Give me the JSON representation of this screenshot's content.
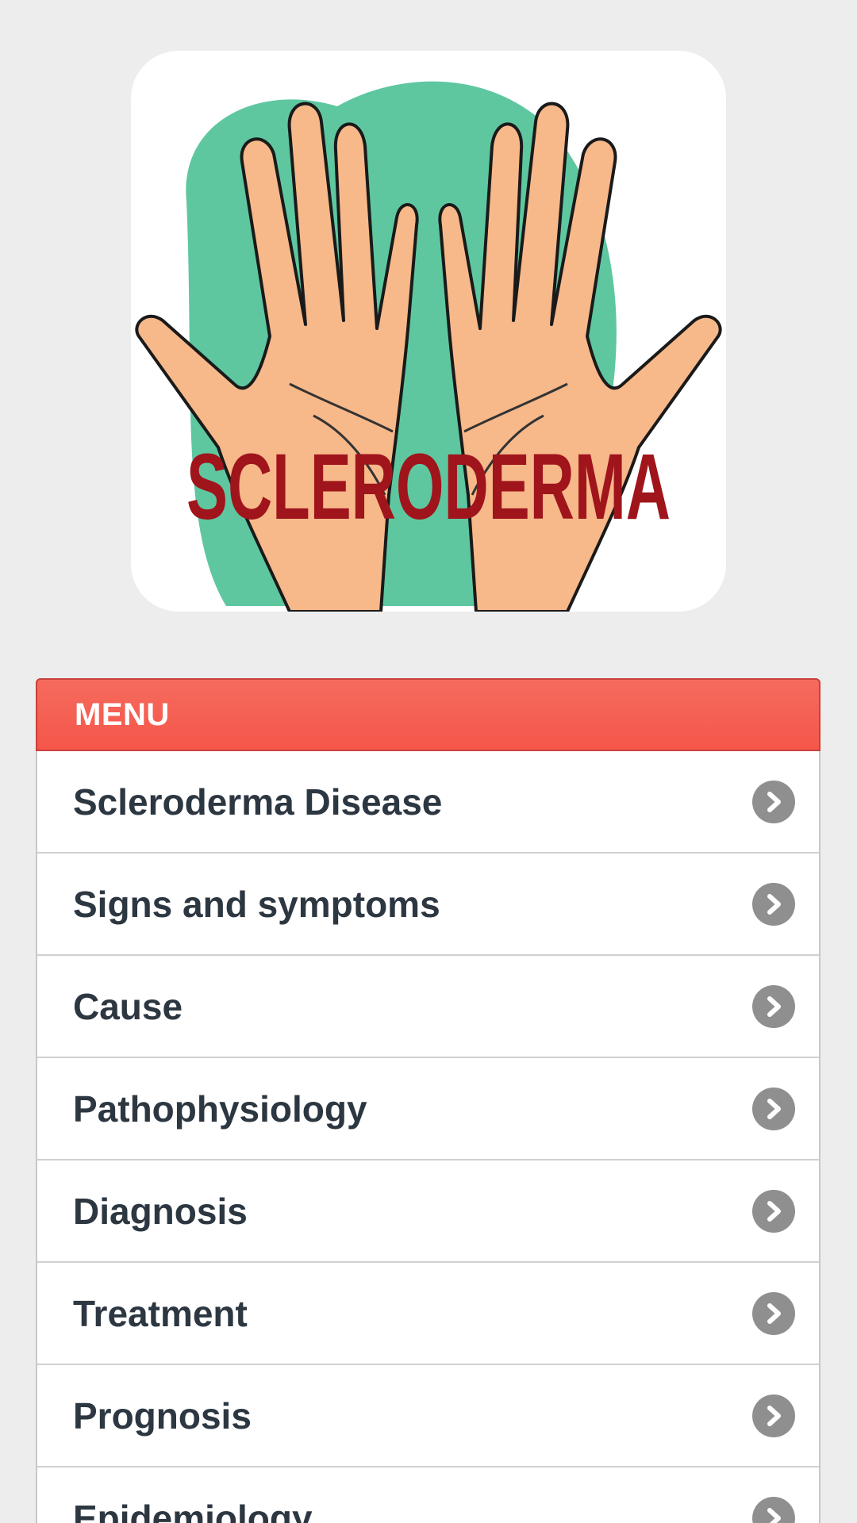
{
  "hero": {
    "logo_text": "SCLERODERMA",
    "icon": "scleroderma-hands-logo"
  },
  "menu": {
    "title": "MENU",
    "items": [
      {
        "label": "Scleroderma Disease",
        "icon": "chevron-right-icon"
      },
      {
        "label": "Signs and symptoms",
        "icon": "chevron-right-icon"
      },
      {
        "label": "Cause",
        "icon": "chevron-right-icon"
      },
      {
        "label": "Pathophysiology",
        "icon": "chevron-right-icon"
      },
      {
        "label": "Diagnosis",
        "icon": "chevron-right-icon"
      },
      {
        "label": "Treatment",
        "icon": "chevron-right-icon"
      },
      {
        "label": "Prognosis",
        "icon": "chevron-right-icon"
      },
      {
        "label": "Epidemiology",
        "icon": "chevron-right-icon"
      }
    ]
  },
  "colors": {
    "background": "#ededed",
    "menu_header": "#f5564a",
    "item_text": "#2d3741",
    "chevron_bg": "#8f8f8f",
    "logo_text": "#a0141c",
    "logo_blob": "#5ec7a0",
    "skin": "#f7b88a"
  }
}
